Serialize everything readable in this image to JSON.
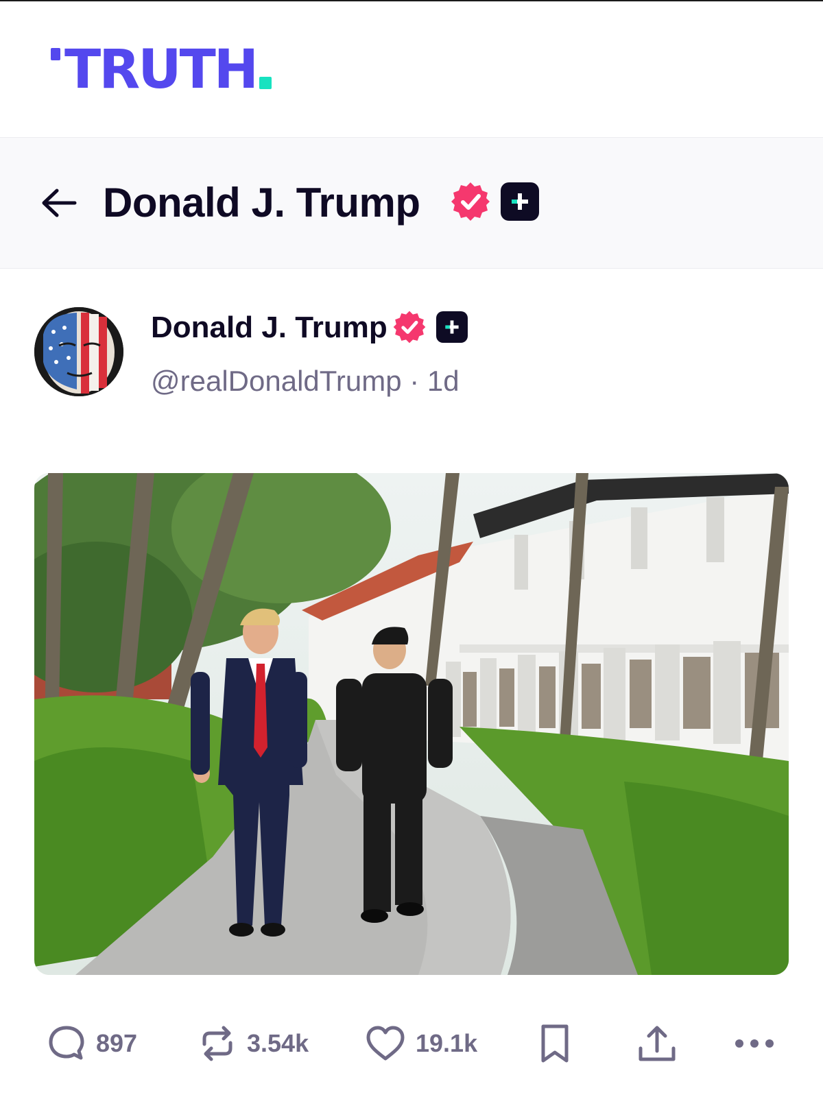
{
  "brand": {
    "name": "TRUTH",
    "color": "#5448ee",
    "dot_color": "#17e2c0"
  },
  "header": {
    "back_icon": "arrow-left-icon",
    "title": "Donald J. Trump"
  },
  "post": {
    "author_name": "Donald J. Trump",
    "handle": "@realDonaldTrump",
    "separator": "·",
    "time": "1d"
  },
  "actions": {
    "replies": "897",
    "reposts": "3.54k",
    "likes": "19.1k"
  },
  "icons": {
    "verified": "verified-badge-icon",
    "plus": "truth-plus-icon",
    "reply": "reply-bubble-icon",
    "repost": "repost-icon",
    "like": "heart-icon",
    "bookmark": "bookmark-icon",
    "share": "share-upload-icon",
    "more": "more-dots-icon"
  },
  "colors": {
    "verified": "#f5386e",
    "text": "#0f0a24",
    "muted": "#6f6a86"
  }
}
